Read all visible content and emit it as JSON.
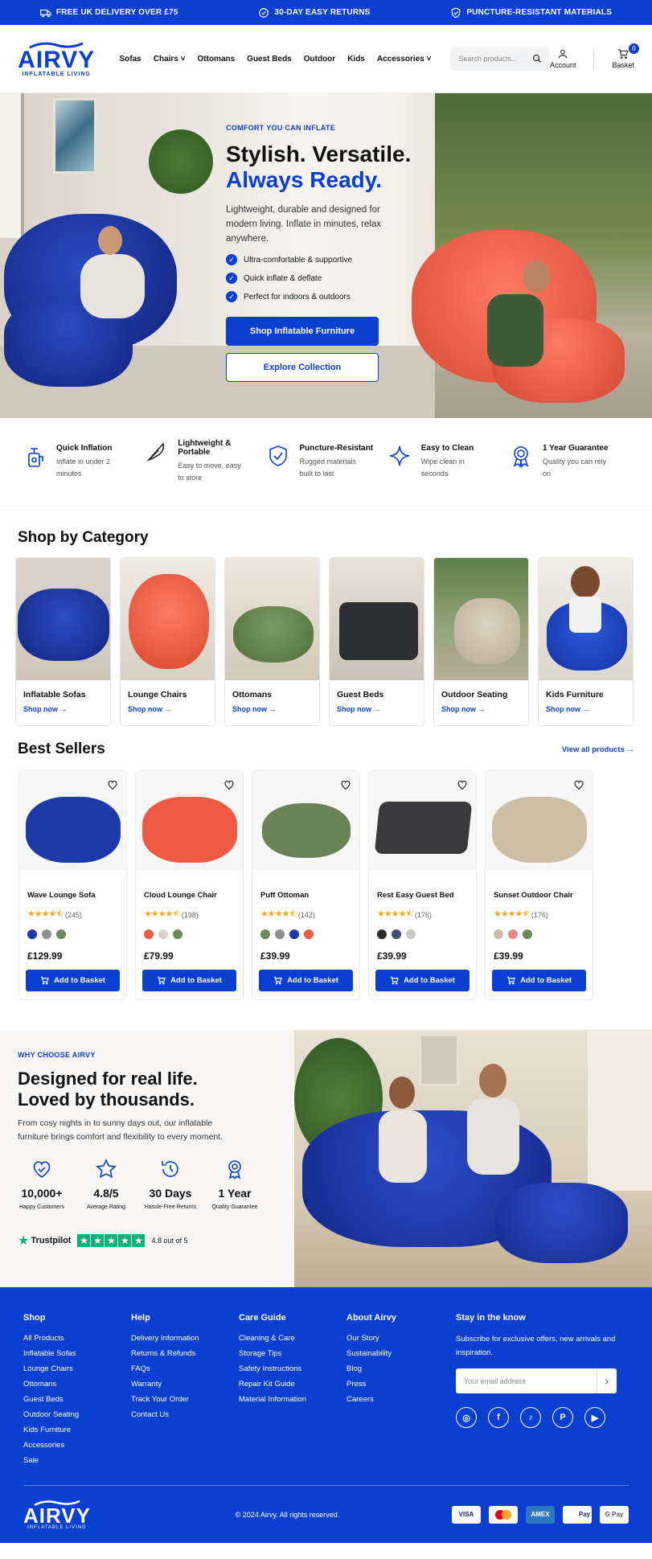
{
  "topbar": {
    "items": [
      "FREE UK DELIVERY OVER £75",
      "30-DAY EASY RETURNS",
      "PUNCTURE-RESISTANT MATERIALS"
    ]
  },
  "brand": {
    "name": "AIRVY",
    "tagline": "INFLATABLE LIVING"
  },
  "nav": [
    "Sofas",
    "Chairs",
    "Ottomans",
    "Guest Beds",
    "Outdoor",
    "Kids",
    "Accessories"
  ],
  "search": {
    "placeholder": "Search products..."
  },
  "header": {
    "account": "Account",
    "basket": "Basket",
    "basket_count": "0"
  },
  "hero": {
    "kicker": "COMFORT YOU CAN INFLATE",
    "title_1": "Stylish. Versatile.",
    "title_2": "Always Ready.",
    "subtitle": "Lightweight, durable and designed for modern living. Inflate in minutes, relax anywhere.",
    "checks": [
      "Ultra-comfortable & supportive",
      "Quick inflate & deflate",
      "Perfect for indoors & outdoors"
    ],
    "primary_cta": "Shop Inflatable Furniture",
    "secondary_cta": "Explore Collection"
  },
  "features": [
    {
      "title": "Quick Inflation",
      "desc": "Inflate in under 2 minutes",
      "icon": "pump-icon"
    },
    {
      "title": "Lightweight & Portable",
      "desc": "Easy to move, easy to store",
      "icon": "feather-icon"
    },
    {
      "title": "Puncture-Resistant",
      "desc": "Rugged materials built to last",
      "icon": "shield-icon"
    },
    {
      "title": "Easy to Clean",
      "desc": "Wipe clean in seconds",
      "icon": "sparkle-icon"
    },
    {
      "title": "1 Year Guarantee",
      "desc": "Quality you can rely on",
      "icon": "award-icon"
    }
  ],
  "categories": {
    "title": "Shop by Category",
    "link": "Shop now",
    "items": [
      "Inflatable Sofas",
      "Lounge Chairs",
      "Ottomans",
      "Guest Beds",
      "Outdoor Seating",
      "Kids Furniture"
    ]
  },
  "bestsellers": {
    "title": "Best Sellers",
    "view_all": "View all products",
    "add_label": "Add to Basket",
    "products": [
      {
        "name": "Wave Lounge Sofa",
        "reviews": "(245)",
        "price": "£129.99",
        "rating": 4.5,
        "color": "#1e3aa8",
        "swatches": [
          "#1e3aa8",
          "#8f8f8f",
          "#6f8a5a"
        ]
      },
      {
        "name": "Cloud Lounge Chair",
        "reviews": "(198)",
        "price": "£79.99",
        "rating": 4.5,
        "color": "#ef5a45",
        "swatches": [
          "#ef5a45",
          "#d8d4cb",
          "#6f8a5a"
        ]
      },
      {
        "name": "Puff Ottoman",
        "reviews": "(142)",
        "price": "£39.99",
        "rating": 4.5,
        "color": "#6f8a5a",
        "swatches": [
          "#6f8a5a",
          "#8f8f8f",
          "#1e3aa8",
          "#ef5a45"
        ]
      },
      {
        "name": "Rest Easy Guest Bed",
        "reviews": "(176)",
        "price": "£39.99",
        "rating": 4.5,
        "color": "#3a3a3c",
        "swatches": [
          "#2b2b2b",
          "#3f4f7a",
          "#c8c8c8"
        ]
      },
      {
        "name": "Sunset Outdoor Chair",
        "reviews": "(176)",
        "price": "£39.99",
        "rating": 4.5,
        "color": "#cdbfa6",
        "swatches": [
          "#cdbfa6",
          "#e98a8a",
          "#6f8a5a"
        ]
      }
    ]
  },
  "why": {
    "kicker": "WHY CHOOSE AIRVY",
    "title_1": "Designed for real life.",
    "title_2": "Loved by thousands.",
    "subtitle": "From cosy nights in to sunny days out, our inflatable furniture brings comfort and flexibility to every moment.",
    "stats": [
      {
        "value": "10,000+",
        "label": "Happy Customers"
      },
      {
        "value": "4.8/5",
        "label": "Average Rating"
      },
      {
        "value": "30 Days",
        "label": "Hassle-Free Returns"
      },
      {
        "value": "1 Year",
        "label": "Quality Guarantee"
      }
    ],
    "trustpilot": "Trustpilot",
    "trust_score": "4.8 out of 5"
  },
  "footer": {
    "cols": [
      {
        "title": "Shop",
        "items": [
          "All Products",
          "Inflatable Sofas",
          "Lounge Chairs",
          "Ottomans",
          "Guest Beds",
          "Outdoor Seating",
          "Kids Furniture",
          "Accessories",
          "Sale"
        ]
      },
      {
        "title": "Help",
        "items": [
          "Delivery Information",
          "Returns & Refunds",
          "FAQs",
          "Warranty",
          "Track Your Order",
          "Contact Us"
        ]
      },
      {
        "title": "Care Guide",
        "items": [
          "Cleaning & Care",
          "Storage Tips",
          "Safety Instructions",
          "Repair Kit Guide",
          "Material Information"
        ]
      },
      {
        "title": "About Airvy",
        "items": [
          "Our Story",
          "Sustainability",
          "Blog",
          "Press",
          "Careers"
        ]
      }
    ],
    "news_title": "Stay in the know",
    "news_desc": "Subscribe for exclusive offers, new arrivals and inspiration.",
    "email_placeholder": "Your email address",
    "copyright": "© 2024 Airvy. All rights reserved.",
    "payments": [
      "VISA",
      "MC",
      "AMEX",
      "Pay",
      "G Pay"
    ]
  }
}
